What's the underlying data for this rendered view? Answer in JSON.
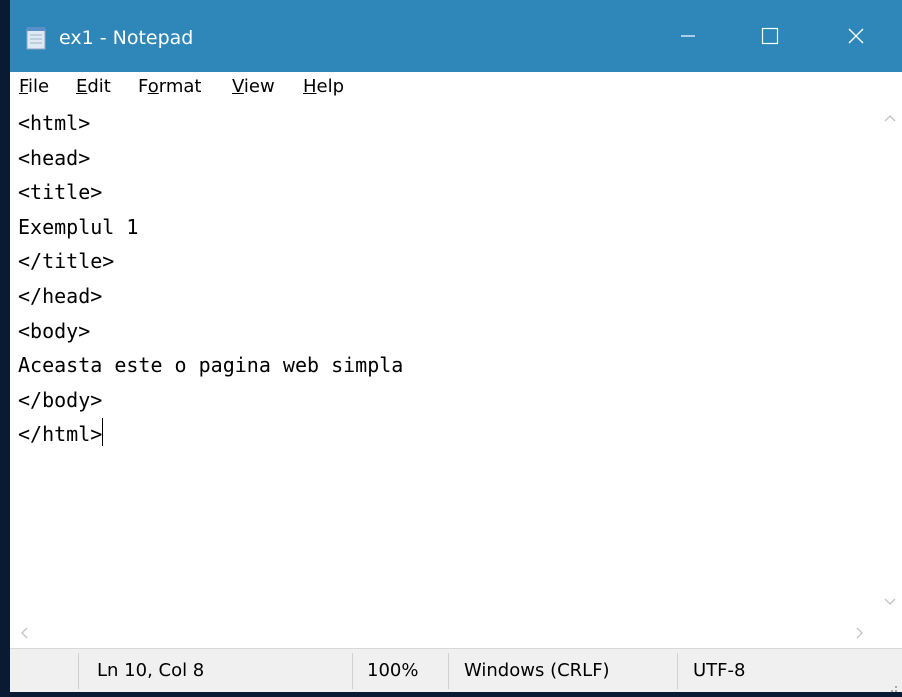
{
  "window": {
    "title": "ex1 - Notepad",
    "titlebar_color": "#2f86b8",
    "icons": {
      "app": "notepad-icon",
      "minimize": "minimize-icon",
      "maximize": "maximize-icon",
      "close": "close-icon"
    }
  },
  "menu": {
    "file": {
      "acc": "F",
      "rest": "ile"
    },
    "edit": {
      "acc": "E",
      "rest": "dit"
    },
    "format": {
      "pre": "F",
      "acc": "o",
      "rest": "rmat"
    },
    "view": {
      "acc": "V",
      "rest": "iew"
    },
    "help": {
      "acc": "H",
      "rest": "elp"
    }
  },
  "editor": {
    "lines": [
      "<html>",
      "<head>",
      "<title>",
      "Exemplul 1",
      "</title>",
      "</head>",
      "<body>",
      "Aceasta este o pagina web simpla",
      "</body>",
      "</html>"
    ]
  },
  "status": {
    "position": "Ln 10, Col 8",
    "zoom": "100%",
    "line_ending": "Windows (CRLF)",
    "encoding": "UTF-8"
  }
}
